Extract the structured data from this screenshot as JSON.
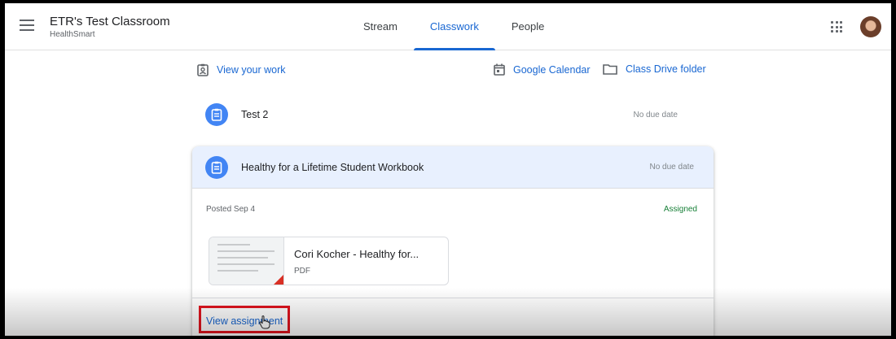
{
  "header": {
    "class_name": "ETR's Test Classroom",
    "class_section": "HealthSmart",
    "tabs": [
      {
        "label": "Stream"
      },
      {
        "label": "Classwork"
      },
      {
        "label": "People"
      }
    ],
    "active_tab": "Classwork",
    "icons": [
      "menu-icon",
      "apps-icon",
      "avatar"
    ]
  },
  "links": {
    "view_work": "View your work",
    "calendar": "Google Calendar",
    "drive": "Class Drive folder"
  },
  "assignments": [
    {
      "title": "Test 2",
      "due": "No due date"
    },
    {
      "title": "Healthy for a Lifetime Student Workbook",
      "due": "No due date"
    }
  ],
  "expanded": {
    "posted": "Posted Sep 4",
    "status": "Assigned",
    "attachment": {
      "name": "Cori Kocher - Healthy for...",
      "type": "PDF"
    },
    "view_button": "View assignment"
  },
  "colors": {
    "accent": "#1967d2",
    "badge": "#4285f4",
    "highlight": "#e8f0fe",
    "assigned": "#188038",
    "annotation": "#e1141e"
  }
}
